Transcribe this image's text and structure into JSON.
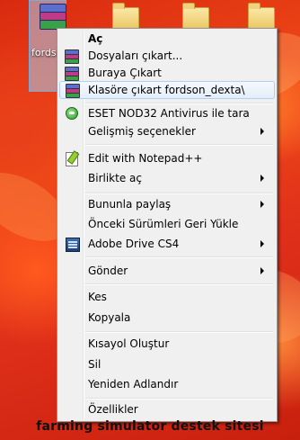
{
  "desktop": {
    "selected_icon_label": "fordson_dexta"
  },
  "menu": {
    "items": [
      {
        "label": "Aç",
        "bold": true
      },
      {
        "label": "Dosyaları çıkart..."
      },
      {
        "label": "Buraya Çıkart"
      },
      {
        "label": "Klasöre çıkart fordson_dexta\\"
      },
      {
        "label": "ESET NOD32 Antivirus ile tara"
      },
      {
        "label": "Gelişmiş seçenekler",
        "submenu": true
      },
      {
        "label": "Edit with Notepad++"
      },
      {
        "label": "Birlikte aç",
        "submenu": true
      },
      {
        "label": "Bununla paylaş",
        "submenu": true
      },
      {
        "label": "Önceki Sürümleri Geri Yükle"
      },
      {
        "label": "Adobe Drive CS4",
        "submenu": true
      },
      {
        "label": "Gönder",
        "submenu": true
      },
      {
        "label": "Kes"
      },
      {
        "label": "Kopyala"
      },
      {
        "label": "Kısayol Oluştur"
      },
      {
        "label": "Sil"
      },
      {
        "label": "Yeniden Adlandır"
      },
      {
        "label": "Özellikler"
      }
    ]
  },
  "caption": "farming simulator destek sitesi"
}
